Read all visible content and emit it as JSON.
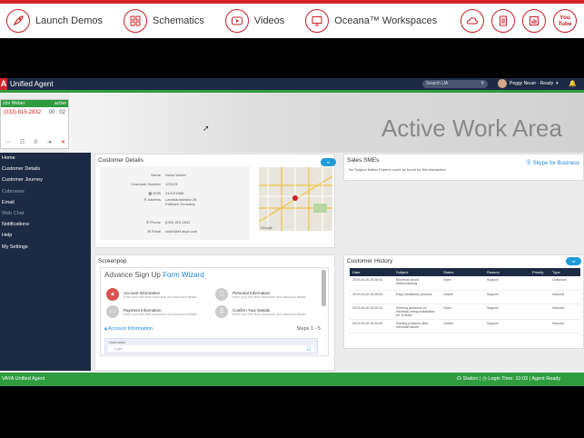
{
  "top_nav": {
    "items": [
      {
        "label": "Launch Demos",
        "icon": "rocket-icon"
      },
      {
        "label": "Schematics",
        "icon": "grid-icon"
      },
      {
        "label": "Videos",
        "icon": "play-icon"
      },
      {
        "label": "Oceana™ Workspaces",
        "icon": "monitor-icon"
      }
    ],
    "right_icons": [
      "cloud-icon",
      "document-icon",
      "bar-chart-icon",
      "youtube-icon"
    ],
    "youtube_text": "You Tube"
  },
  "app": {
    "title": "Unified Agent",
    "logo_letter": "A",
    "search_placeholder": "Search UA",
    "user_status": "Peggy Neuer · Ready",
    "hero_title": "Active Work Area",
    "phone": {
      "name": "ctor Weber",
      "status": "active",
      "number": "(033) 815-2832",
      "timer": "00 : 02"
    },
    "sidebar": [
      {
        "label": "Home",
        "dim": false
      },
      {
        "label": "Customer Details",
        "dim": false
      },
      {
        "label": "Customer Journey",
        "dim": false
      },
      {
        "label": "Cobrowse",
        "dim": true
      },
      {
        "label": "Email",
        "dim": false
      },
      {
        "label": "Web Chat",
        "dim": true
      },
      {
        "label": "Notifications",
        "dim": false
      },
      {
        "label": "Help",
        "dim": false
      },
      {
        "label": "My Settings",
        "dim": false
      }
    ],
    "customer_details": {
      "title": "Customer Details",
      "rows": [
        {
          "label": "Name",
          "value": "Victor Weber"
        },
        {
          "label": "Customer Number",
          "value": "123123"
        },
        {
          "label": "DOB",
          "value": "21/12/1968"
        },
        {
          "label": "Address",
          "value": "Landhausstraße 26 Fellbach Germany"
        },
        {
          "label": "Phone",
          "value": "(033) 815-2832"
        },
        {
          "label": "Email",
          "value": "victor@ef.avya.com"
        }
      ],
      "map_credit": "Google"
    },
    "sales_smes": {
      "title": "Sales SMEs",
      "skype": "Skype for Business",
      "empty_text": "No Subject Matter Experts could be found for this interaction"
    },
    "screenpop": {
      "title": "Screenpop",
      "wizard_title": "Advance Sign Up",
      "wizard_accent": "Form Wizard",
      "items": [
        {
          "title": "Account Information",
          "sub": "Enter your first time username and password details"
        },
        {
          "title": "Personal Information",
          "sub": "Enter your first time username and password details"
        },
        {
          "title": "Payment Information",
          "sub": "Enter your first time username and password details"
        },
        {
          "title": "Confirm Your Details",
          "sub": "Enter your first time username and password details"
        }
      ],
      "section": "Account Information",
      "steps": "Steps 1 - 5",
      "username_label": "Username",
      "username_placeholder": "Login"
    },
    "history": {
      "title": "Customer History",
      "columns": [
        "Date",
        "Subject",
        "Status",
        "Reason",
        "Priority",
        "Type"
      ],
      "rows": [
        [
          "2019-04-26 15:26:41",
          "Electrical circuit malfunctioning",
          "Open",
          "Support",
          "",
          "Outbound"
        ],
        [
          "2019-04-26 15:26:54",
          "Easy installation process",
          "Closed",
          "Support",
          "",
          "Inbound"
        ],
        [
          "2019-04-26 15:25:14",
          "Seeking guidance on electrical wiring installation for 1C6464",
          "Open",
          "Support",
          "",
          "Inbound"
        ],
        [
          "2019-04-26 15:24:52",
          "Starting pressure after electrical failure",
          "Closed",
          "Support",
          "",
          "Inbound"
        ]
      ]
    },
    "footer": {
      "brand": "VAYA Unified Agent",
      "station": "Station",
      "login_time": "Login Time: 10:03",
      "agent_state": "Agent Ready"
    }
  },
  "colors": {
    "brand_red": "#d2232a",
    "navy": "#1d2a44",
    "green": "#2e9c3f",
    "link_blue": "#1e8ad7"
  }
}
